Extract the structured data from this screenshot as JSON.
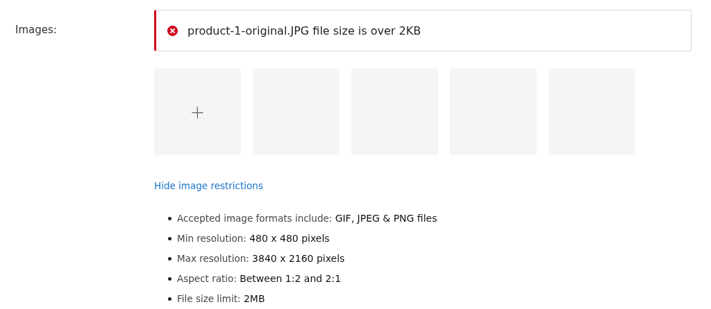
{
  "field_label": "Images:",
  "alert": {
    "kind": "error",
    "message": "product-1-original.JPG file size is over 2KB"
  },
  "tiles": [
    {
      "kind": "add",
      "icon": "+"
    },
    {
      "kind": "empty"
    },
    {
      "kind": "empty"
    },
    {
      "kind": "empty"
    },
    {
      "kind": "empty"
    }
  ],
  "restrictions_link": "Hide image restrictions",
  "restrictions": [
    {
      "label": "Accepted image formats include:",
      "value": "GIF, JPEG & PNG files"
    },
    {
      "label": "Min resolution:",
      "value": "480 x 480 pixels"
    },
    {
      "label": "Max resolution:",
      "value": "3840 x 2160 pixels"
    },
    {
      "label": "Aspect ratio:",
      "value": "Between 1:2 and 2:1"
    },
    {
      "label": "File size limit:",
      "value": "2MB"
    }
  ]
}
